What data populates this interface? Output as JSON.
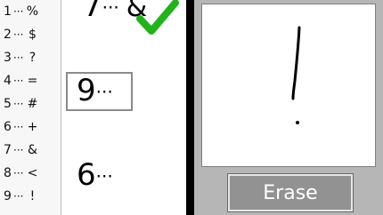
{
  "key": [
    {
      "num": "1",
      "dots": "···",
      "sym": "%"
    },
    {
      "num": "2",
      "dots": "···",
      "sym": "$"
    },
    {
      "num": "3",
      "dots": "···",
      "sym": "?"
    },
    {
      "num": "4",
      "dots": "···",
      "sym": "="
    },
    {
      "num": "5",
      "dots": "···",
      "sym": "#"
    },
    {
      "num": "6",
      "dots": "···",
      "sym": "+"
    },
    {
      "num": "7",
      "dots": "···",
      "sym": "&"
    },
    {
      "num": "8",
      "dots": "···",
      "sym": "<"
    },
    {
      "num": "9",
      "dots": "···",
      "sym": "!"
    }
  ],
  "sequence": {
    "previous": {
      "num": "7",
      "dots": "···",
      "answer": "&",
      "status": "correct"
    },
    "current": {
      "num": "9",
      "dots": "···"
    },
    "next": {
      "num": "6",
      "dots": "···"
    }
  },
  "pad": {
    "handwritten": "!"
  },
  "erase_button": {
    "label": "Erase"
  },
  "colors": {
    "check": "#22b21a",
    "divider": "#000000",
    "panel": "#b6b6b6",
    "button": "#929292"
  }
}
